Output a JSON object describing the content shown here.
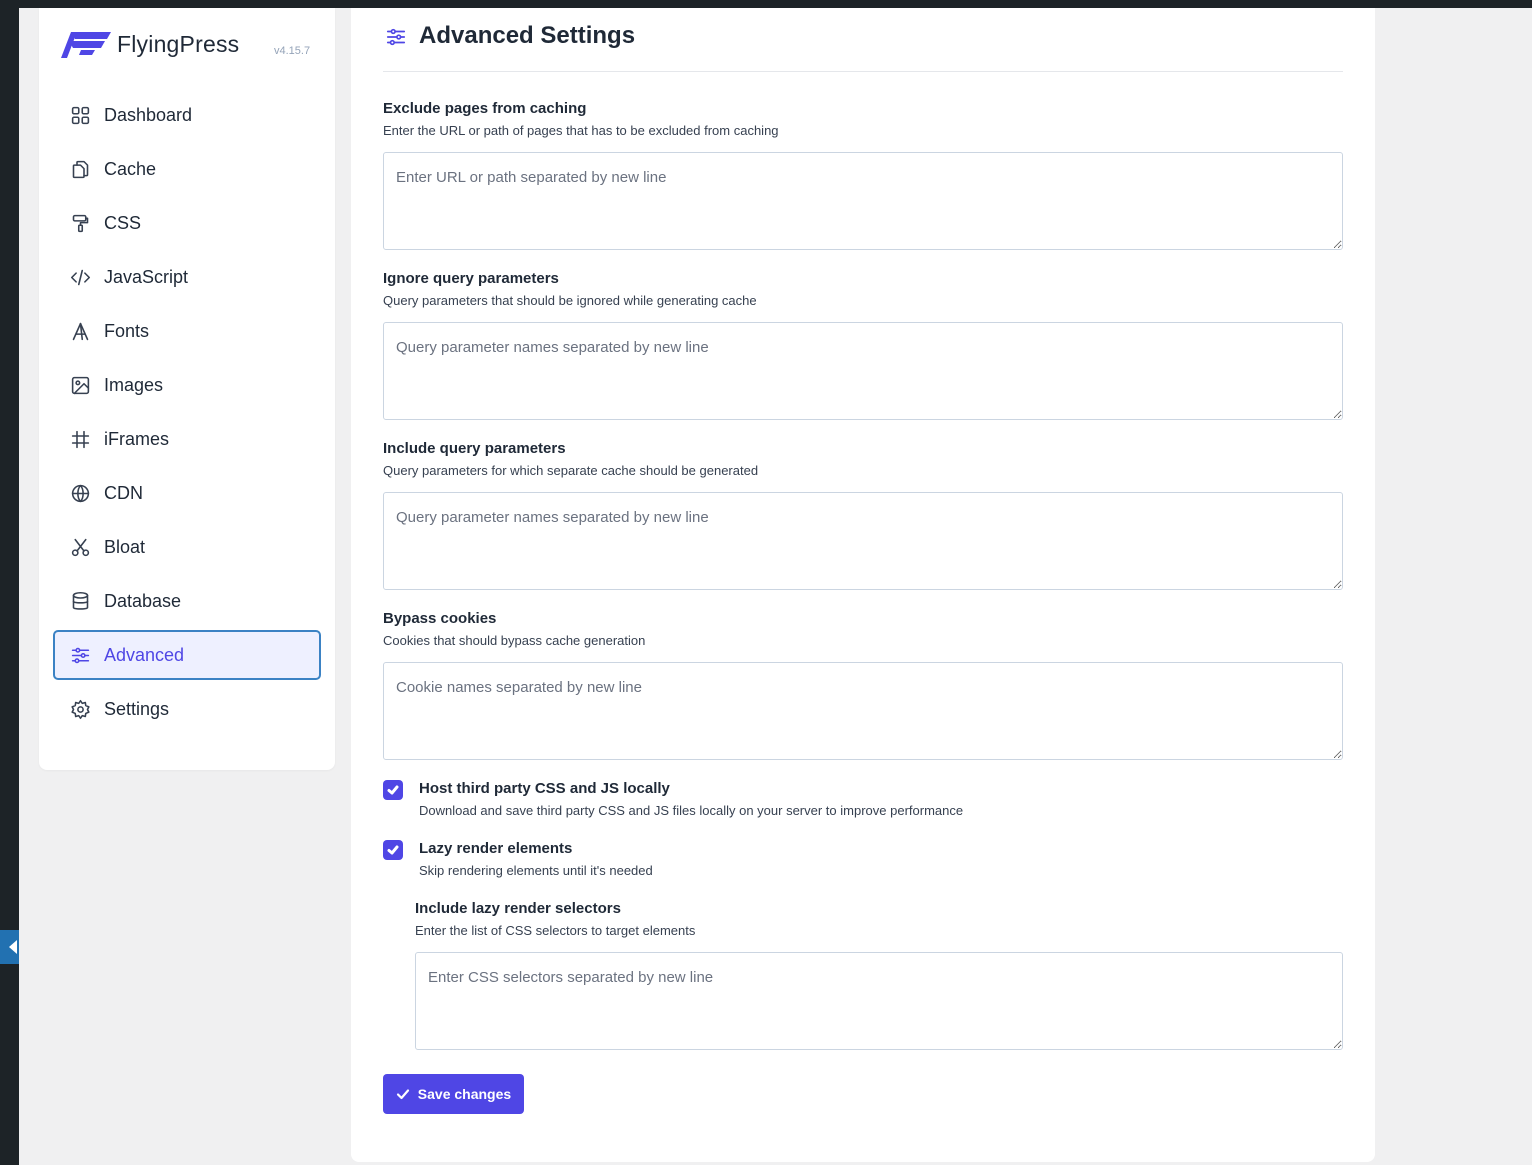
{
  "brand": {
    "name": "FlyingPress",
    "version": "v4.15.7",
    "accent": "#4f46e5"
  },
  "sidebar": {
    "items": [
      {
        "label": "Dashboard",
        "icon": "dashboard-icon"
      },
      {
        "label": "Cache",
        "icon": "files-icon"
      },
      {
        "label": "CSS",
        "icon": "paint-roller-icon"
      },
      {
        "label": "JavaScript",
        "icon": "code-icon"
      },
      {
        "label": "Fonts",
        "icon": "font-icon"
      },
      {
        "label": "Images",
        "icon": "image-icon"
      },
      {
        "label": "iFrames",
        "icon": "hash-icon"
      },
      {
        "label": "CDN",
        "icon": "globe-icon"
      },
      {
        "label": "Bloat",
        "icon": "scissors-icon"
      },
      {
        "label": "Database",
        "icon": "database-icon"
      },
      {
        "label": "Advanced",
        "icon": "sliders-icon",
        "active": true
      },
      {
        "label": "Settings",
        "icon": "gear-icon"
      }
    ]
  },
  "page": {
    "title": "Advanced Settings",
    "icon": "sliders-icon"
  },
  "fields": [
    {
      "label": "Exclude pages from caching",
      "desc": "Enter the URL or path of pages that has to be excluded from caching",
      "placeholder": "Enter URL or path separated by new line",
      "value": ""
    },
    {
      "label": "Ignore query parameters",
      "desc": "Query parameters that should be ignored while generating cache",
      "placeholder": "Query parameter names separated by new line",
      "value": ""
    },
    {
      "label": "Include query parameters",
      "desc": "Query parameters for which separate cache should be generated",
      "placeholder": "Query parameter names separated by new line",
      "value": ""
    },
    {
      "label": "Bypass cookies",
      "desc": "Cookies that should bypass cache generation",
      "placeholder": "Cookie names separated by new line",
      "value": ""
    }
  ],
  "checks": [
    {
      "title": "Host third party CSS and JS locally",
      "desc": "Download and save third party CSS and JS files locally on your server to improve performance",
      "checked": true
    },
    {
      "title": "Lazy render elements",
      "desc": "Skip rendering elements until it's needed",
      "checked": true
    }
  ],
  "lazy_selectors": {
    "label": "Include lazy render selectors",
    "desc": "Enter the list of CSS selectors to target elements",
    "placeholder": "Enter CSS selectors separated by new line",
    "value": ""
  },
  "save_label": "Save changes"
}
